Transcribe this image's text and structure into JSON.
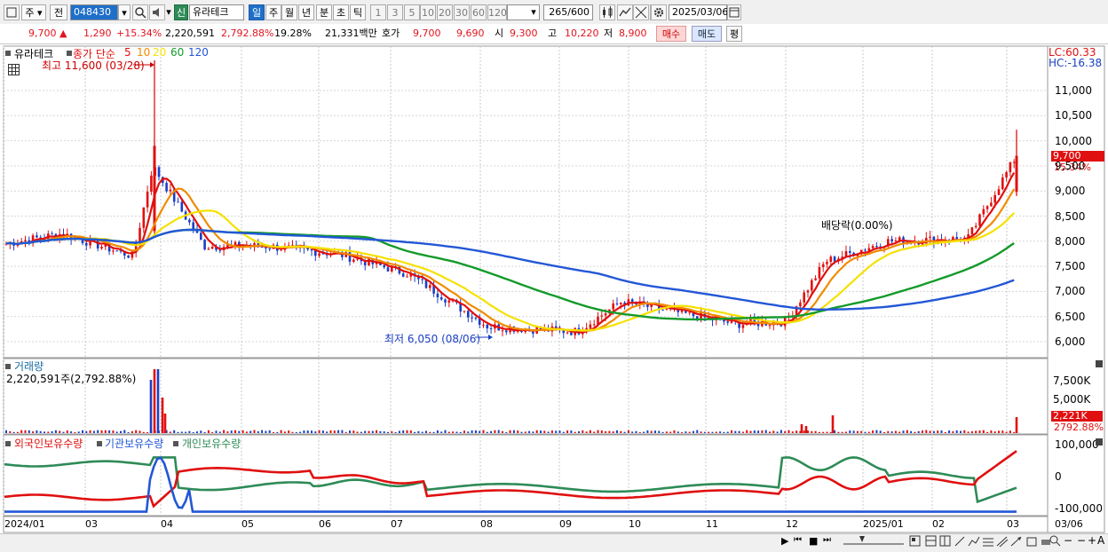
{
  "toolbar": {
    "market_type": "주",
    "prev_label": "전",
    "stock_code": "048430",
    "new_badge": "신",
    "stock_name": "유라테크",
    "periods": [
      "일",
      "주",
      "월",
      "년",
      "분",
      "초",
      "틱"
    ],
    "active_period": "일",
    "intervals": [
      "1",
      "3",
      "5",
      "10",
      "20",
      "30",
      "60",
      "120"
    ],
    "count": "265",
    "count_max": "/600",
    "date": "2025/03/06"
  },
  "quote": {
    "price": "9,700",
    "arrow": "▲",
    "change": "1,290",
    "change_pct": "+15.34%",
    "volume": "2,220,591",
    "volume_pct": "2,792.88%",
    "turnover": "19.28%",
    "amount": "21,331백만",
    "hoga_label": "호가",
    "ask": "9,700",
    "bid": "9,690",
    "open_label": "시",
    "open": "9,300",
    "high_label": "고",
    "high": "10,220",
    "low_label": "저",
    "low": "8,900",
    "buy_btn": "매수",
    "sell_btn": "매도",
    "eval_btn": "평"
  },
  "price_panel": {
    "name": "유라테크",
    "legend_prefix": "종가 단순",
    "ma_periods": [
      "5",
      "10",
      "20",
      "60",
      "120"
    ],
    "ma_colors": [
      "#e01010",
      "#f08c00",
      "#f5e100",
      "#149a2a",
      "#2357d6"
    ],
    "max_label": "최고 11,600 (03/28)",
    "min_label": "최저 6,050 (08/06)",
    "dividend_label": "배당락(0.00%)",
    "lc_label": "LC:60.33",
    "hc_label": "HC:-16.38",
    "y_ticks": [
      "11,000",
      "10,500",
      "10,000",
      "9,500",
      "9,000",
      "8,500",
      "8,000",
      "7,500",
      "7,000",
      "6,500",
      "6,000"
    ],
    "last_price_tag": "9,700",
    "last_pct_tag": "15.34%"
  },
  "volume_panel": {
    "title": "거래량",
    "value_label": "2,220,591주(2,792.88%)",
    "y_ticks": [
      "7,500K",
      "5,000K"
    ],
    "last_tag": "2,221K",
    "last_pct": "2792.88%"
  },
  "holder_panel": {
    "legend": [
      "외국인보유수량",
      "기관보유수량",
      "개인보유수량"
    ],
    "colors": [
      "#e01010",
      "#2357d6",
      "#2e8b57"
    ],
    "y_ticks": [
      "100,000",
      "0",
      "-100,000"
    ]
  },
  "x_axis": [
    "2024/01",
    "03",
    "04",
    "05",
    "06",
    "07",
    "08",
    "09",
    "10",
    "11",
    "12",
    "2025/01",
    "02",
    "03",
    "03/06"
  ],
  "chart_data": {
    "type": "candlestick",
    "title": "유라테크",
    "price_range": [
      5850,
      11700
    ],
    "months": [
      "2024/01",
      "03",
      "04",
      "05",
      "06",
      "07",
      "08",
      "09",
      "10",
      "11",
      "12",
      "2025/01",
      "02",
      "03"
    ],
    "approx_close_path": [
      {
        "date": "2024/01",
        "close": 7950
      },
      {
        "date": "2024/02",
        "close": 8150
      },
      {
        "date": "2024/03",
        "close": 7700
      },
      {
        "date": "2024/03/28",
        "close": 9500,
        "high": 11600
      },
      {
        "date": "2024/04",
        "close": 7900
      },
      {
        "date": "2024/05",
        "close": 7900
      },
      {
        "date": "2024/06",
        "close": 7750
      },
      {
        "date": "2024/07",
        "close": 7350
      },
      {
        "date": "2024/08/06",
        "close": 6300,
        "low": 6050
      },
      {
        "date": "2024/09",
        "close": 6200
      },
      {
        "date": "2024/10",
        "close": 6800
      },
      {
        "date": "2024/11",
        "close": 6350
      },
      {
        "date": "2024/12",
        "close": 6400
      },
      {
        "date": "2024/12/mid",
        "close": 7600
      },
      {
        "date": "2025/01",
        "close": 8000
      },
      {
        "date": "2025/02",
        "close": 8050
      },
      {
        "date": "2025/03/06",
        "close": 9700,
        "open": 9300,
        "high": 10220,
        "low": 8900
      }
    ],
    "volume_last": 2220591,
    "holders_range": [
      -100000,
      100000
    ]
  }
}
